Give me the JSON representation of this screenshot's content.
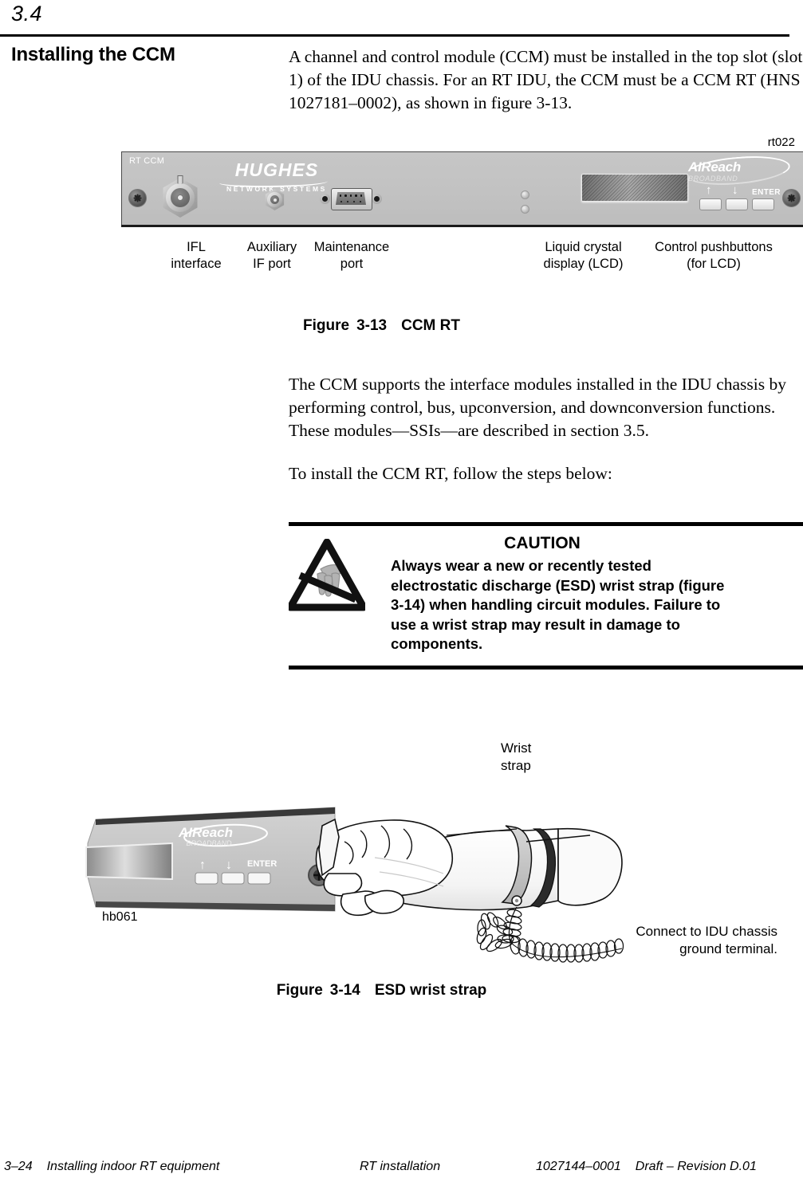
{
  "header": {
    "section_number": "3.4",
    "section_title": "Installing the CCM"
  },
  "body": {
    "intro_paragraph": "A channel and control module (CCM) must be installed in the top slot (slot 1) of the IDU chassis. For an RT IDU, the CCM must be a CCM RT (HNS 1027181–0002), as shown in figure 3-13.",
    "paragraph_two": "The CCM supports the interface modules installed in the IDU chassis by performing control, bus, upconversion, and downconversion functions. These modules—SSIs—are described in section 3.5.",
    "paragraph_three": "To install the CCM RT, follow the steps below:"
  },
  "figure_13": {
    "graphic_id": "rt022",
    "panel_label": "RT CCM",
    "brand_primary": "HUGHES",
    "brand_secondary": "NETWORK SYSTEMS",
    "product_brand": "AIReach",
    "product_brand_sub": "BROADBAND",
    "buttons": {
      "up": "↑",
      "down": "↓",
      "enter": "ENTER"
    },
    "callouts": [
      {
        "line1": "IFL",
        "line2": "interface"
      },
      {
        "line1": "Auxiliary",
        "line2": "IF port"
      },
      {
        "line1": "Maintenance",
        "line2": "port"
      },
      {
        "line1": "Liquid crystal",
        "line2": "display (LCD)"
      },
      {
        "line1": "Control pushbuttons",
        "line2": "(for LCD)"
      }
    ],
    "caption_word": "Figure",
    "caption_number": "3-13",
    "caption_title": "CCM RT"
  },
  "caution": {
    "title": "CAUTION",
    "text": "Always wear a new or recently tested electrostatic discharge (ESD) wrist strap (figure 3-14) when handling circuit modules. Failure to use a wrist strap may result in damage to components.",
    "icon": "esd-warning-triangle-icon"
  },
  "figure_14": {
    "graphic_id": "hb061",
    "label_wrist_strap": "Wrist\nstrap",
    "label_wrist_strap_line1": "Wrist",
    "label_wrist_strap_line2": "strap",
    "label_ground_line1": "Connect to IDU chassis",
    "label_ground_line2": "ground terminal.",
    "product_brand": "AIReach",
    "product_brand_sub": "BROADBAND",
    "buttons": {
      "up": "↑",
      "down": "↓",
      "enter": "ENTER"
    },
    "caption_word": "Figure",
    "caption_number": "3-14",
    "caption_title": "ESD wrist strap"
  },
  "footer": {
    "left_page": "3–24",
    "left_text": "Installing indoor RT equipment",
    "center": "RT installation",
    "right_doc": "1027144–0001",
    "right_rev": "Draft – Revision D.01"
  },
  "colors": {
    "panel_gray": "#c3c3c3",
    "rule_black": "#000000",
    "esd_hand_gray": "#b3b3b3"
  }
}
